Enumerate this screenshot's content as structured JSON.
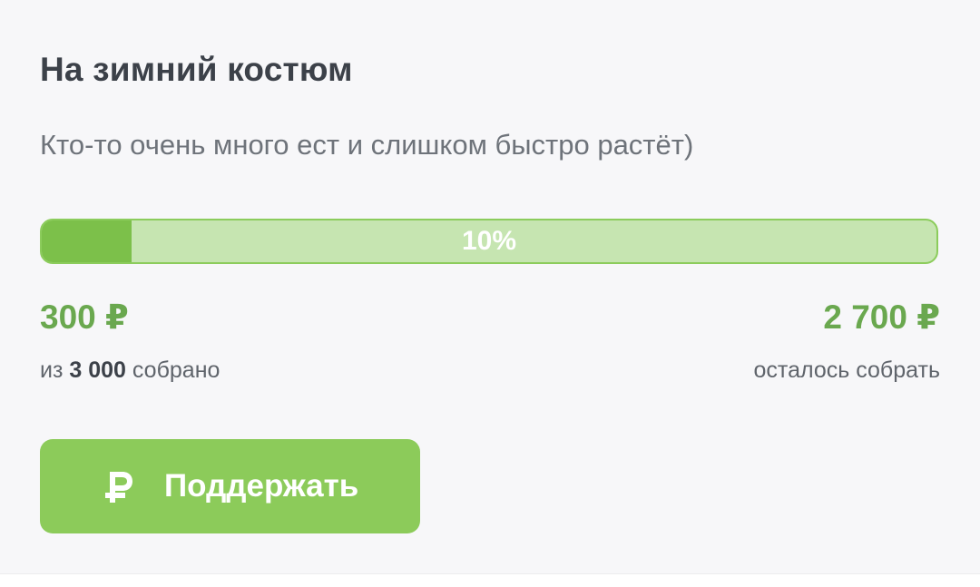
{
  "fundraiser": {
    "title": "На зимний костюм",
    "description": "Кто-то очень много ест и слишком быстро растёт)",
    "progress_percent": 10,
    "progress_label": "10%",
    "collected_amount": "300 ₽",
    "goal_prefix": "из ",
    "goal_value": "3 000",
    "goal_suffix": " собрано",
    "remaining_amount": "2 700 ₽",
    "remaining_label": "осталось собрать",
    "support_button_label": "Поддержать",
    "support_icon": "ruble-icon"
  },
  "colors": {
    "accent_green": "#6aa84f",
    "button_green": "#8ccb5a",
    "progress_fill": "#7cc04a",
    "progress_track": "#c6e5b1"
  }
}
